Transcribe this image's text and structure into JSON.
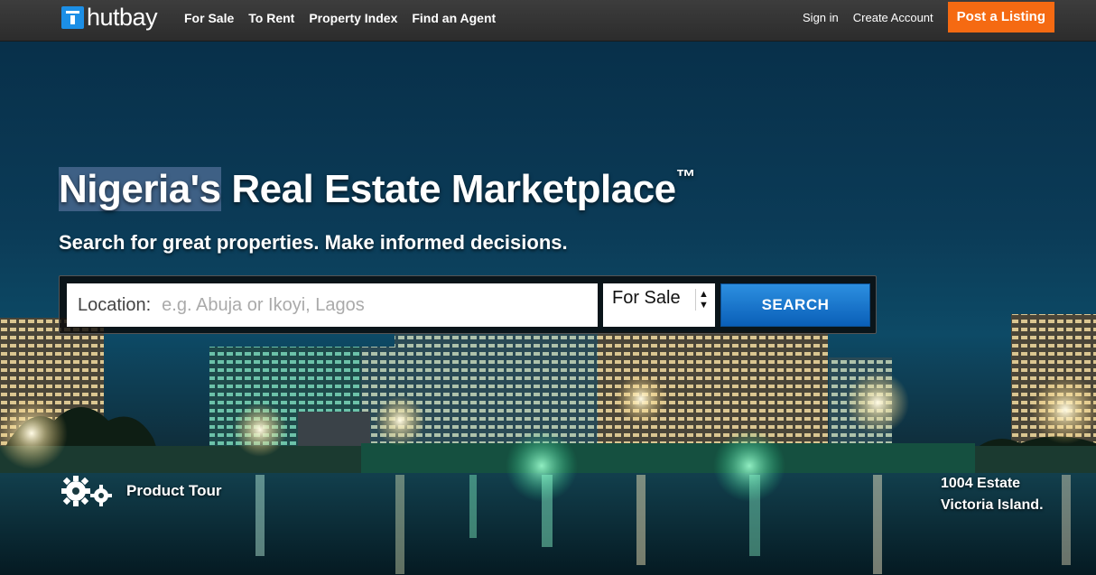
{
  "brand": {
    "name": "hutbay"
  },
  "nav": {
    "left": [
      "For Sale",
      "To Rent",
      "Property Index",
      "Find an Agent"
    ],
    "sign_in": "Sign in",
    "create_account": "Create Account",
    "post_listing": "Post a Listing"
  },
  "hero": {
    "headline_highlight": "Nigeria's",
    "headline_rest": "Real Estate Marketplace",
    "trademark": "™",
    "subhead": "Search for great properties. Make informed decisions."
  },
  "search": {
    "location_label": "Location:",
    "location_placeholder": "e.g. Abuja or Ikoyi, Lagos",
    "type_selected": "For Sale",
    "button": "SEARCH"
  },
  "tour": {
    "label": "Product Tour"
  },
  "photo_caption": {
    "line1": "1004 Estate",
    "line2": "Victoria Island."
  },
  "colors": {
    "accent": "#f56a12",
    "brand": "#1c8fe6",
    "search_button": "#1a7ad0",
    "topbar": "#333333"
  }
}
